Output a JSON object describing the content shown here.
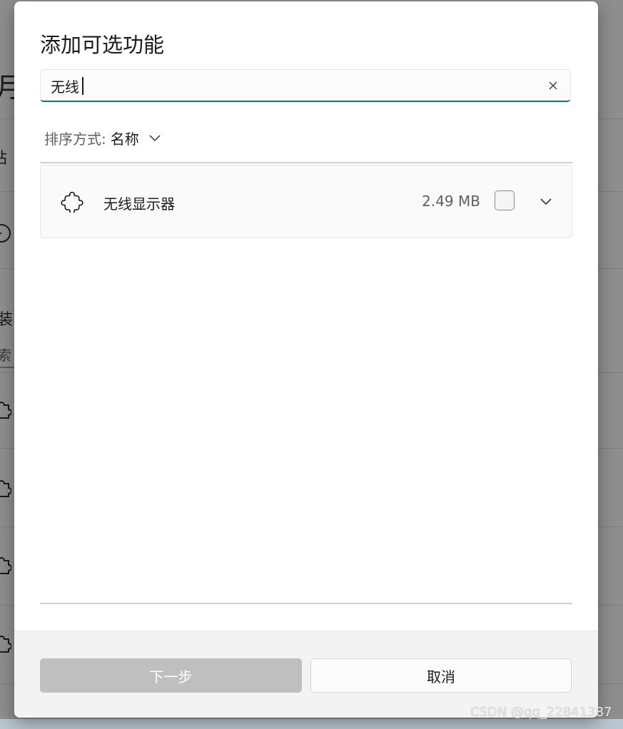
{
  "background": {
    "fragments": [
      "月",
      "站",
      "装",
      "索"
    ]
  },
  "dialog": {
    "title": "添加可选功能",
    "search": {
      "value": "无线",
      "placeholder": ""
    },
    "sort": {
      "label": "排序方式:",
      "value": "名称"
    },
    "features": [
      {
        "name": "无线显示器",
        "size": "2.49 MB",
        "checked": false,
        "icon": "puzzle-icon"
      }
    ],
    "buttons": {
      "next": "下一步",
      "cancel": "取消"
    }
  },
  "watermark": "CSDN @qq_22841387",
  "colors": {
    "accent": "#0f6cbd",
    "disabled_button": "#bfbfbf"
  }
}
